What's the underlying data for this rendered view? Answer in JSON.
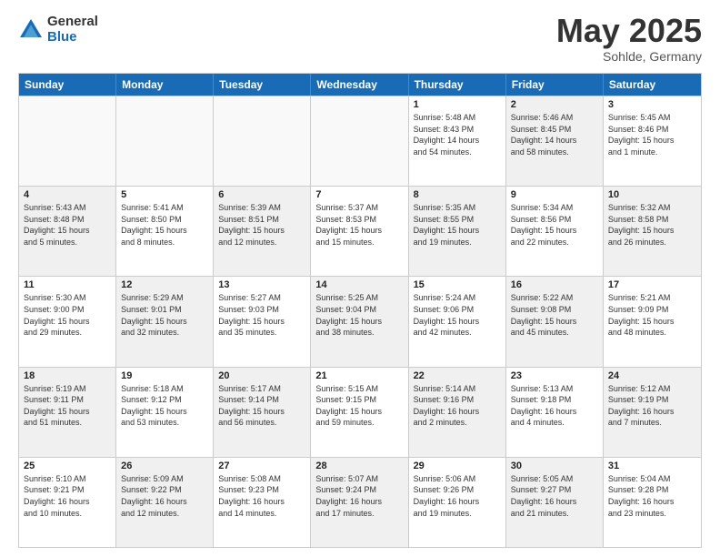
{
  "logo": {
    "general": "General",
    "blue": "Blue"
  },
  "title": {
    "month": "May 2025",
    "location": "Sohlde, Germany"
  },
  "header": {
    "days": [
      "Sunday",
      "Monday",
      "Tuesday",
      "Wednesday",
      "Thursday",
      "Friday",
      "Saturday"
    ]
  },
  "weeks": [
    [
      {
        "day": "",
        "info": "",
        "shaded": false,
        "empty": true
      },
      {
        "day": "",
        "info": "",
        "shaded": false,
        "empty": true
      },
      {
        "day": "",
        "info": "",
        "shaded": false,
        "empty": true
      },
      {
        "day": "",
        "info": "",
        "shaded": false,
        "empty": true
      },
      {
        "day": "1",
        "info": "Sunrise: 5:48 AM\nSunset: 8:43 PM\nDaylight: 14 hours\nand 54 minutes.",
        "shaded": false,
        "empty": false
      },
      {
        "day": "2",
        "info": "Sunrise: 5:46 AM\nSunset: 8:45 PM\nDaylight: 14 hours\nand 58 minutes.",
        "shaded": true,
        "empty": false
      },
      {
        "day": "3",
        "info": "Sunrise: 5:45 AM\nSunset: 8:46 PM\nDaylight: 15 hours\nand 1 minute.",
        "shaded": false,
        "empty": false
      }
    ],
    [
      {
        "day": "4",
        "info": "Sunrise: 5:43 AM\nSunset: 8:48 PM\nDaylight: 15 hours\nand 5 minutes.",
        "shaded": true,
        "empty": false
      },
      {
        "day": "5",
        "info": "Sunrise: 5:41 AM\nSunset: 8:50 PM\nDaylight: 15 hours\nand 8 minutes.",
        "shaded": false,
        "empty": false
      },
      {
        "day": "6",
        "info": "Sunrise: 5:39 AM\nSunset: 8:51 PM\nDaylight: 15 hours\nand 12 minutes.",
        "shaded": true,
        "empty": false
      },
      {
        "day": "7",
        "info": "Sunrise: 5:37 AM\nSunset: 8:53 PM\nDaylight: 15 hours\nand 15 minutes.",
        "shaded": false,
        "empty": false
      },
      {
        "day": "8",
        "info": "Sunrise: 5:35 AM\nSunset: 8:55 PM\nDaylight: 15 hours\nand 19 minutes.",
        "shaded": true,
        "empty": false
      },
      {
        "day": "9",
        "info": "Sunrise: 5:34 AM\nSunset: 8:56 PM\nDaylight: 15 hours\nand 22 minutes.",
        "shaded": false,
        "empty": false
      },
      {
        "day": "10",
        "info": "Sunrise: 5:32 AM\nSunset: 8:58 PM\nDaylight: 15 hours\nand 26 minutes.",
        "shaded": true,
        "empty": false
      }
    ],
    [
      {
        "day": "11",
        "info": "Sunrise: 5:30 AM\nSunset: 9:00 PM\nDaylight: 15 hours\nand 29 minutes.",
        "shaded": false,
        "empty": false
      },
      {
        "day": "12",
        "info": "Sunrise: 5:29 AM\nSunset: 9:01 PM\nDaylight: 15 hours\nand 32 minutes.",
        "shaded": true,
        "empty": false
      },
      {
        "day": "13",
        "info": "Sunrise: 5:27 AM\nSunset: 9:03 PM\nDaylight: 15 hours\nand 35 minutes.",
        "shaded": false,
        "empty": false
      },
      {
        "day": "14",
        "info": "Sunrise: 5:25 AM\nSunset: 9:04 PM\nDaylight: 15 hours\nand 38 minutes.",
        "shaded": true,
        "empty": false
      },
      {
        "day": "15",
        "info": "Sunrise: 5:24 AM\nSunset: 9:06 PM\nDaylight: 15 hours\nand 42 minutes.",
        "shaded": false,
        "empty": false
      },
      {
        "day": "16",
        "info": "Sunrise: 5:22 AM\nSunset: 9:08 PM\nDaylight: 15 hours\nand 45 minutes.",
        "shaded": true,
        "empty": false
      },
      {
        "day": "17",
        "info": "Sunrise: 5:21 AM\nSunset: 9:09 PM\nDaylight: 15 hours\nand 48 minutes.",
        "shaded": false,
        "empty": false
      }
    ],
    [
      {
        "day": "18",
        "info": "Sunrise: 5:19 AM\nSunset: 9:11 PM\nDaylight: 15 hours\nand 51 minutes.",
        "shaded": true,
        "empty": false
      },
      {
        "day": "19",
        "info": "Sunrise: 5:18 AM\nSunset: 9:12 PM\nDaylight: 15 hours\nand 53 minutes.",
        "shaded": false,
        "empty": false
      },
      {
        "day": "20",
        "info": "Sunrise: 5:17 AM\nSunset: 9:14 PM\nDaylight: 15 hours\nand 56 minutes.",
        "shaded": true,
        "empty": false
      },
      {
        "day": "21",
        "info": "Sunrise: 5:15 AM\nSunset: 9:15 PM\nDaylight: 15 hours\nand 59 minutes.",
        "shaded": false,
        "empty": false
      },
      {
        "day": "22",
        "info": "Sunrise: 5:14 AM\nSunset: 9:16 PM\nDaylight: 16 hours\nand 2 minutes.",
        "shaded": true,
        "empty": false
      },
      {
        "day": "23",
        "info": "Sunrise: 5:13 AM\nSunset: 9:18 PM\nDaylight: 16 hours\nand 4 minutes.",
        "shaded": false,
        "empty": false
      },
      {
        "day": "24",
        "info": "Sunrise: 5:12 AM\nSunset: 9:19 PM\nDaylight: 16 hours\nand 7 minutes.",
        "shaded": true,
        "empty": false
      }
    ],
    [
      {
        "day": "25",
        "info": "Sunrise: 5:10 AM\nSunset: 9:21 PM\nDaylight: 16 hours\nand 10 minutes.",
        "shaded": false,
        "empty": false
      },
      {
        "day": "26",
        "info": "Sunrise: 5:09 AM\nSunset: 9:22 PM\nDaylight: 16 hours\nand 12 minutes.",
        "shaded": true,
        "empty": false
      },
      {
        "day": "27",
        "info": "Sunrise: 5:08 AM\nSunset: 9:23 PM\nDaylight: 16 hours\nand 14 minutes.",
        "shaded": false,
        "empty": false
      },
      {
        "day": "28",
        "info": "Sunrise: 5:07 AM\nSunset: 9:24 PM\nDaylight: 16 hours\nand 17 minutes.",
        "shaded": true,
        "empty": false
      },
      {
        "day": "29",
        "info": "Sunrise: 5:06 AM\nSunset: 9:26 PM\nDaylight: 16 hours\nand 19 minutes.",
        "shaded": false,
        "empty": false
      },
      {
        "day": "30",
        "info": "Sunrise: 5:05 AM\nSunset: 9:27 PM\nDaylight: 16 hours\nand 21 minutes.",
        "shaded": true,
        "empty": false
      },
      {
        "day": "31",
        "info": "Sunrise: 5:04 AM\nSunset: 9:28 PM\nDaylight: 16 hours\nand 23 minutes.",
        "shaded": false,
        "empty": false
      }
    ]
  ]
}
